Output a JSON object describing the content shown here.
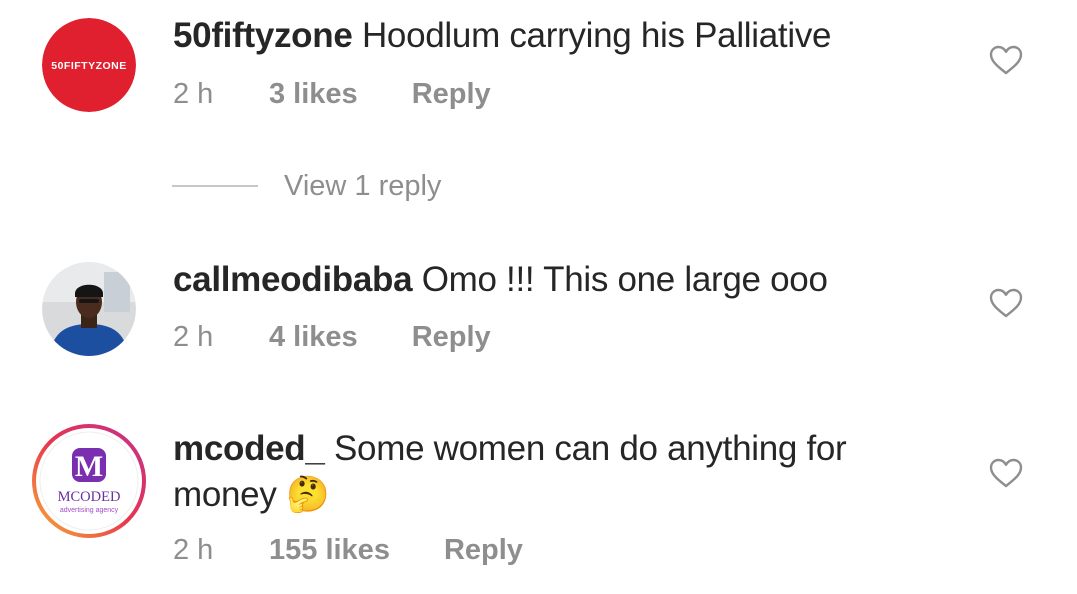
{
  "comments": [
    {
      "username": "50fiftyzone",
      "text": "Hoodlum carrying his Palliative",
      "time": "2 h",
      "likes": "3 likes",
      "reply_label": "Reply",
      "avatar_text": "50FIFTYZONE",
      "avatar_color": "#e0202f",
      "view_replies": "View 1 reply"
    },
    {
      "username": "callmeodibaba",
      "text": "Omo !!! This one large ooo",
      "time": "2 h",
      "likes": "4 likes",
      "reply_label": "Reply"
    },
    {
      "username": "mcoded_",
      "text": "Some women can do anything for money",
      "emoji": "🤔",
      "time": "2 h",
      "likes": "155 likes",
      "reply_label": "Reply",
      "avatar_text": "MCODED",
      "avatar_subtext": "advertising agency",
      "avatar_color": "#6b2fa0"
    }
  ],
  "icons": {
    "like": "heart-outline-icon"
  }
}
